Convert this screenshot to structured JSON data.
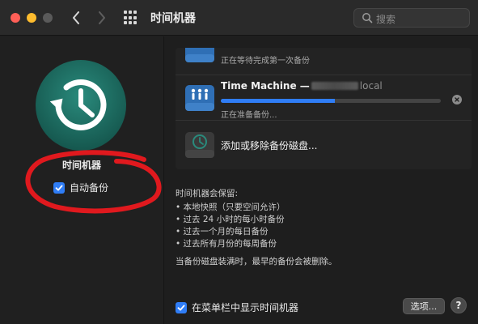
{
  "window": {
    "title": "时间机器",
    "search_placeholder": "搜索"
  },
  "sidebar": {
    "app_name": "时间机器",
    "auto_backup_label": "自动备份",
    "auto_backup_checked": true
  },
  "disks": [
    {
      "title": "",
      "subtitle": "正在等待完成第一次备份",
      "icon": "network-disk-icon"
    },
    {
      "title": "Time Machine",
      "title_suffix": "local",
      "subtitle": "正在准备备份...",
      "progress": 0.52,
      "icon": "network-disk-icon"
    },
    {
      "title": "添加或移除备份磁盘...",
      "icon": "time-machine-disk-icon"
    }
  ],
  "keep": {
    "title": "时间机器会保留:",
    "items": [
      "• 本地快照（只要空间允许）",
      "• 过去 24 小时的每小时备份",
      "• 过去一个月的每日备份",
      "• 过去所有月份的每周备份"
    ],
    "note": "当备份磁盘装满时，最早的备份会被删除。"
  },
  "footer": {
    "show_in_menubar_label": "在菜单栏中显示时间机器",
    "show_in_menubar_checked": true,
    "options_label": "选项...",
    "help_label": "?"
  },
  "colors": {
    "accent": "#2f7df6",
    "annotation": "#e0191e",
    "logo_green": "#1f6e63"
  }
}
